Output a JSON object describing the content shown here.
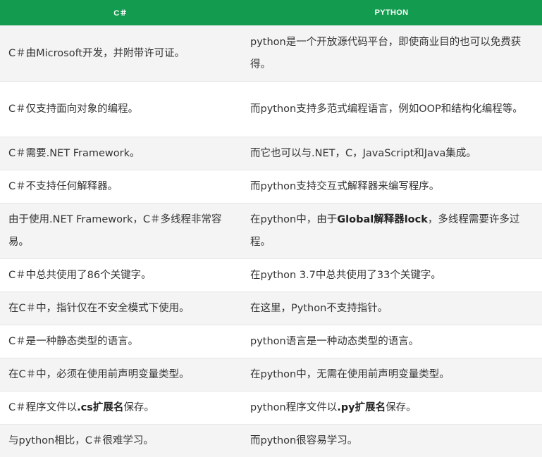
{
  "table": {
    "headers": [
      "C＃",
      "PYTHON"
    ],
    "rows": [
      {
        "csharp": [
          "C＃由Microsoft开发，并附带许可证。"
        ],
        "python": [
          "python是一个开放源代码平台，即使商业目的也可以免费获得。"
        ]
      },
      {
        "csharp": [
          "C＃仅支持面向对象的编程。"
        ],
        "python": [
          "而python支持多范式编程语言，例如OOP和结构化编程等。"
        ]
      },
      {
        "csharp": [
          "C＃需要.NET Framework。"
        ],
        "python": [
          "而它也可以与.NET，C，JavaScript和Java集成。"
        ]
      },
      {
        "csharp": [
          "C＃不支持任何解释器。"
        ],
        "python": [
          "而python支持交互式解释器来编写程序。"
        ]
      },
      {
        "csharp": [
          "由于使用.NET Framework，C＃多线程非常容易。"
        ],
        "python": [
          "在python中，由于",
          "Global解释器lock",
          "，多线程需要许多过程。"
        ]
      },
      {
        "csharp": [
          "C＃中总共使用了86个关键字。"
        ],
        "python": [
          "在python 3.7中总共使用了33个关键字。"
        ]
      },
      {
        "csharp": [
          "在C＃中，指针仅在不安全模式下使用。"
        ],
        "python": [
          "在这里，Python不支持指针。"
        ]
      },
      {
        "csharp": [
          "C＃是一种静态类型的语言。"
        ],
        "python": [
          "python语言是一种动态类型的语言。"
        ]
      },
      {
        "csharp": [
          "在C＃中，必须在使用前声明变量类型。"
        ],
        "python": [
          "在python中，无需在使用前声明变量类型。"
        ]
      },
      {
        "csharp": [
          "C＃程序文件以",
          ".cs扩展名",
          "保存。"
        ],
        "python": [
          "python程序文件以",
          ".py扩展名",
          "保存。"
        ]
      },
      {
        "csharp": [
          "与python相比，C＃很难学习。"
        ],
        "python": [
          "而python很容易学习。"
        ]
      }
    ]
  }
}
